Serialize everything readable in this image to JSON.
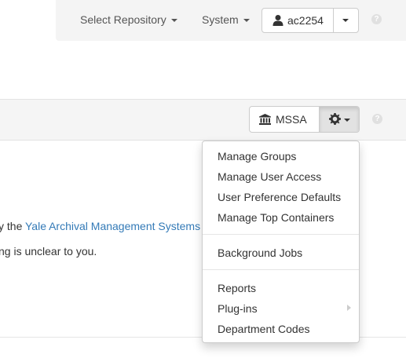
{
  "navbar": {
    "select_repository": "Select Repository",
    "system": "System",
    "user": "ac2254"
  },
  "context": {
    "repository": "MSSA"
  },
  "content": {
    "line1_prefix": "y the ",
    "line1_link": "Yale Archival Management Systems",
    "line2": "ng is unclear to you."
  },
  "dropdown": {
    "items": [
      "Manage Groups",
      "Manage User Access",
      "User Preference Defaults",
      "Manage Top Containers",
      "Background Jobs",
      "Reports",
      "Plug-ins",
      "Department Codes"
    ]
  },
  "help_icon": "?",
  "colors": {
    "link": "#337ab7",
    "navbar_bg": "#f4f4f4",
    "active_button": "#e2e2e2"
  },
  "icons": [
    "user-icon",
    "bank-icon",
    "gear-icon",
    "help-icon",
    "caret-icon",
    "submenu-arrow-icon"
  ]
}
